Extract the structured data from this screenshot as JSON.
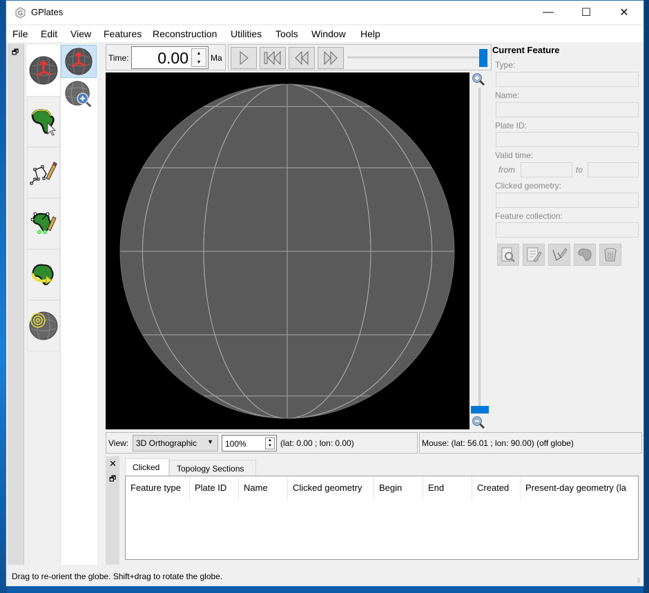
{
  "window": {
    "title": "GPlates",
    "controls": {
      "minimize": "—",
      "maximize": "☐",
      "close": "✕"
    }
  },
  "menu": [
    "File",
    "Edit",
    "View",
    "Features",
    "Reconstruction",
    "Utilities",
    "Tools",
    "Window",
    "Help"
  ],
  "toolbar": {
    "tools": [
      {
        "name": "globe-drag-tool",
        "icon": "globe-arrows-icon",
        "active": true
      },
      {
        "name": "choose-feature-tool",
        "icon": "africa-cursor-icon",
        "active": false
      },
      {
        "name": "digitise-geometry-tool",
        "icon": "polyline-pencil-icon",
        "active": false
      },
      {
        "name": "edit-topology-tool",
        "icon": "africa-vertices-pencil-icon",
        "active": false
      },
      {
        "name": "modify-reconstruction-pole-tool",
        "icon": "africa-rotate-icon",
        "active": false
      },
      {
        "name": "small-circle-tool",
        "icon": "globe-circles-icon",
        "active": false
      }
    ],
    "subtools": [
      {
        "name": "drag-globe",
        "icon": "globe-arrows-icon",
        "selected": true
      },
      {
        "name": "zoom-globe",
        "icon": "globe-zoom-icon",
        "selected": false
      }
    ]
  },
  "time": {
    "label": "Time:",
    "value": "0.00",
    "unit": "Ma",
    "slider_fraction": 1.0
  },
  "animation": {
    "play": "play-icon",
    "reset": "reset-to-start-icon",
    "step_back": "step-back-icon",
    "step_forward": "step-forward-icon"
  },
  "globe": {
    "background": "#000000",
    "sphere_color": "#5a5a5a",
    "grid_color": "#a8a8a8",
    "zoom_fraction": 0.0
  },
  "current_feature": {
    "title": "Current Feature",
    "type_label": "Type:",
    "type_value": "",
    "name_label": "Name:",
    "name_value": "",
    "plate_id_label": "Plate ID:",
    "plate_id_value": "",
    "valid_time_label": "Valid time:",
    "from_label": "from",
    "from_value": "",
    "to_label": "to",
    "to_value": "",
    "clicked_geometry_label": "Clicked geometry:",
    "clicked_geometry_value": "",
    "feature_collection_label": "Feature collection:",
    "feature_collection_value": "",
    "actions": [
      "query-feature-icon",
      "edit-feature-icon",
      "digitise-edit-icon",
      "build-topology-icon",
      "delete-feature-icon"
    ]
  },
  "view_bar": {
    "view_label": "View:",
    "projection": "3D Orthographic",
    "zoom": "100%",
    "camera_coords": "(lat: 0.00 ; lon: 0.00)",
    "mouse_coords": "Mouse: (lat: 56.01 ; lon: 90.00) (off globe)"
  },
  "bottom_panel": {
    "tabs": [
      {
        "label": "Clicked",
        "active": true
      },
      {
        "label": "Topology Sections",
        "active": false
      }
    ],
    "columns": [
      "Feature type",
      "Plate ID",
      "Name",
      "Clicked geometry",
      "Begin",
      "End",
      "Created",
      "Present-day geometry (la"
    ],
    "rows": []
  },
  "status": "Drag to re-orient the globe. Shift+drag to rotate the globe."
}
